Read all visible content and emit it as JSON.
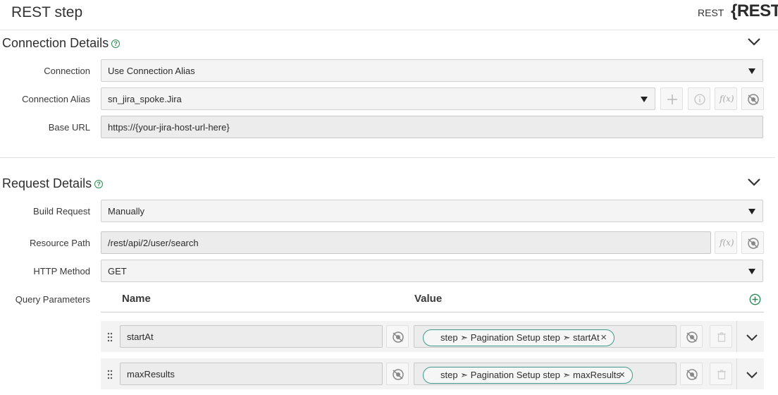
{
  "header": {
    "title": "REST step",
    "type_label": "REST",
    "logo_text": "{REST}"
  },
  "connection_details": {
    "title": "Connection Details",
    "connection": {
      "label": "Connection",
      "value": "Use Connection Alias"
    },
    "alias": {
      "label": "Connection Alias",
      "value": "sn_jira_spoke.Jira"
    },
    "base_url": {
      "label": "Base URL",
      "value": "https://{your-jira-host-url-here}"
    }
  },
  "request_details": {
    "title": "Request Details",
    "build_request": {
      "label": "Build Request",
      "value": "Manually"
    },
    "resource_path": {
      "label": "Resource Path",
      "value": "/rest/api/2/user/search"
    },
    "http_method": {
      "label": "HTTP Method",
      "value": "GET"
    },
    "query_parameters": {
      "label": "Query Parameters",
      "name_header": "Name",
      "value_header": "Value",
      "rows": [
        {
          "name": "startAt",
          "value": "step ➣ Pagination Setup step ➣ startAt"
        },
        {
          "name": "maxResults",
          "value": "step ➣ Pagination Setup step ➣ maxResults"
        }
      ]
    }
  },
  "icons": {
    "help": "help-circle-icon",
    "chevron": "chevron-down-icon",
    "add": "plus-icon",
    "info": "info-icon",
    "fx": "function-icon",
    "data_pill": "data-pill-picker-icon",
    "trash": "trash-icon",
    "grip": "drag-handle-icon"
  },
  "colors": {
    "accent": "#2e8b57",
    "pill_border": "#3d9a8a"
  }
}
